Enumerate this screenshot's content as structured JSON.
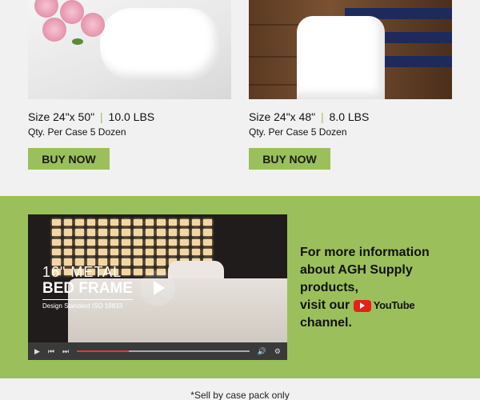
{
  "products": [
    {
      "image_label": "white towel roll with pink roses",
      "size": "Size 24\"x 50\"",
      "weight": "10.0 LBS",
      "qty": "Qty. Per Case 5 Dozen",
      "button": "BUY NOW"
    },
    {
      "image_label": "white and navy striped towel on wood",
      "size": "Size 24\"x 48\"",
      "weight": "8.0 LBS",
      "qty": "Qty. Per Case 5 Dozen",
      "button": "BUY NOW"
    }
  ],
  "separator": "|",
  "video": {
    "title_line1": "16\" METAL",
    "title_line2": "BED FRAME",
    "subtitle": "Design Standard ISO 19833",
    "progress_fraction": 0.3
  },
  "promo": {
    "line1": "For more information",
    "line2": "about AGH Supply",
    "line3": "products,",
    "line4_prefix": "visit our",
    "youtube_word": "YouTube",
    "line5": "channel."
  },
  "footnote": "*Sell by case pack only",
  "colors": {
    "accent_green": "#9bc05b",
    "youtube_red": "#e62117",
    "page_bg": "#f1f1f1"
  }
}
